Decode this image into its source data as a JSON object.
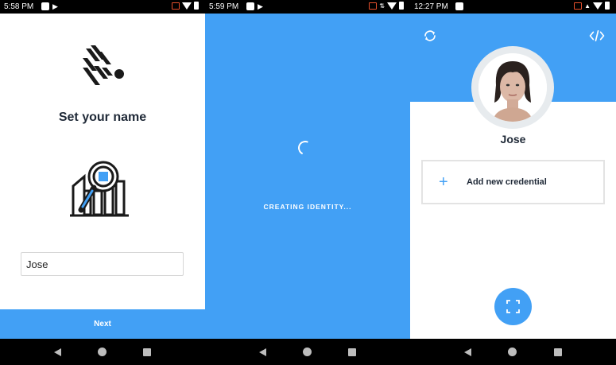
{
  "panels": [
    {
      "status_time": "5:58 PM"
    },
    {
      "status_time": "5:59 PM"
    },
    {
      "status_time": "12:27 PM"
    }
  ],
  "screen1": {
    "title": "Set your name",
    "name_value": "Jose",
    "next_label": "Next",
    "icons": [
      "zebra-logo-icon",
      "search-chart-icon"
    ]
  },
  "screen2": {
    "loading_text": "CREATING IDENTITY..."
  },
  "screen3": {
    "user_name": "Jose",
    "add_credential_label": "Add new credential",
    "add_symbol": "+",
    "icons": [
      "sync-icon",
      "code-icon",
      "avatar",
      "scan-icon"
    ]
  },
  "colors": {
    "accent": "#42a0f5",
    "text_dark": "#1f2937",
    "statusbar": "#000000"
  }
}
